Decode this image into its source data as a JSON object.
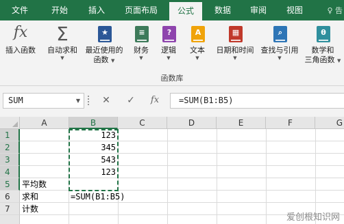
{
  "tabs": [
    {
      "label": "文件",
      "active": false
    },
    {
      "label": "开始",
      "active": false
    },
    {
      "label": "插入",
      "active": false
    },
    {
      "label": "页面布局",
      "active": false
    },
    {
      "label": "公式",
      "active": true
    },
    {
      "label": "数据",
      "active": false
    },
    {
      "label": "审阅",
      "active": false
    },
    {
      "label": "视图",
      "active": false
    }
  ],
  "tab_help": "♀ 告",
  "ribbon": {
    "group_label": "函数库",
    "buttons": [
      {
        "label": "插入函数",
        "icon": "insert-function-icon",
        "glyph": "fx"
      },
      {
        "label": "自动求和",
        "icon": "autosum-icon",
        "glyph": "Σ"
      },
      {
        "label": "最近使用的",
        "label2": "函数",
        "icon": "recently-used-icon",
        "glyph": "★"
      },
      {
        "label": "财务",
        "icon": "financial-icon",
        "glyph": "≡"
      },
      {
        "label": "逻辑",
        "icon": "logical-icon",
        "glyph": "?"
      },
      {
        "label": "文本",
        "icon": "text-icon",
        "glyph": "A"
      },
      {
        "label": "日期和时间",
        "icon": "date-time-icon",
        "glyph": "▦"
      },
      {
        "label": "查找与引用",
        "icon": "lookup-reference-icon",
        "glyph": "⌕"
      },
      {
        "label": "数学和",
        "label2": "三角函数",
        "icon": "math-trig-icon",
        "glyph": "θ"
      }
    ]
  },
  "formula_bar": {
    "name_box": "SUM",
    "cancel": "✕",
    "enter": "✓",
    "fx": "fx",
    "formula": "=SUM(B1:B5)"
  },
  "grid": {
    "columns": [
      "A",
      "B",
      "C",
      "D",
      "E",
      "F",
      "G"
    ],
    "rows": [
      "1",
      "2",
      "3",
      "4",
      "5",
      "6",
      "7"
    ],
    "cells": {
      "B1": "123",
      "B2": "345",
      "B3": "543",
      "B4": "123",
      "A5": "平均数",
      "A6": "求和",
      "A7": "计数",
      "B6": "=SUM(B1:B5)"
    }
  },
  "watermark": "爱创根知识网",
  "colors": {
    "accent": "#217346",
    "ribbon_bg": "#f3f3f3",
    "fx_icon": "#555555",
    "autosum_icon": "#555555",
    "recent_icon": "#2b5797",
    "financial_icon": "#3d7a5a",
    "logical_icon": "#8e44ad",
    "text_icon": "#f0a30a",
    "datetime_icon": "#c0392b",
    "lookup_icon": "#2e75b6",
    "math_icon": "#2f8f9d"
  }
}
